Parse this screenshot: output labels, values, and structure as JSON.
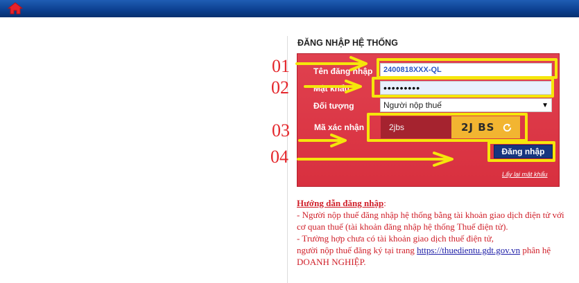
{
  "header": {
    "home_icon": "home-icon",
    "bar_color": "#0b3f8f"
  },
  "login": {
    "title": "ĐĂNG NHẬP HỆ THỐNG",
    "username_label": "Tên đăng nhập",
    "username_value": "2400818XXX-QL",
    "password_label": "Mật khẩu",
    "password_value": "•••••••••",
    "subject_label": "Đối tượng",
    "subject_selected": "Người nộp thuế",
    "captcha_label": "Mã xác nhận",
    "captcha_input_value": "2jbs",
    "captcha_image_text": "2J BS",
    "submit_label": "Đăng nhập",
    "forgot_label": "Lấy lại mật khẩu",
    "panel_color": "#d8303f"
  },
  "annotations": {
    "step1": "01",
    "step2": "02",
    "step3": "03",
    "step4": "04",
    "highlight_color": "#f5e60b",
    "number_color": "#e4262b"
  },
  "guide": {
    "title": "Hướng dẫn đăng nhập",
    "colon": ":",
    "line1": "- Người nộp thuế đăng nhập hệ thống bằng tài khoản giao dịch điện tử với cơ quan thuế (tài khoản đăng nhập hệ thống Thuế điện tử).",
    "line2": "- Trường hợp chưa có tài khoản giao dịch thuế điện tử,",
    "line3_prefix": "người nộp thuế đăng ký tại trang ",
    "link": "https://thuedientu.gdt.gov.vn",
    "line3_suffix": " phân hệ DOANH NGHIỆP."
  }
}
